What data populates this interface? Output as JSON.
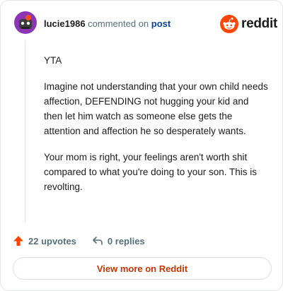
{
  "comment": {
    "username": "lucie1986",
    "action_text": "commented on",
    "target_link": "post",
    "paragraphs": [
      "YTA",
      "Imagine not understanding that your own child needs affection, DEFENDING not hugging your kid and then let him watch as someone else gets the attention and affection he so desperately wants.",
      "Your mom is right, your feelings aren't worth shit compared to what you're doing to your son. This is revolting."
    ]
  },
  "brand": {
    "name": "reddit",
    "icon": "reddit-logo-icon",
    "color": "#ff4500"
  },
  "footer": {
    "upvotes_label": "22 upvotes",
    "replies_label": "0 replies",
    "upvote_icon": "upvote-arrow-icon",
    "reply_icon": "reply-icon",
    "view_more_label": "View more on Reddit"
  },
  "colors": {
    "accent": "#ff4500",
    "link": "#0a449b",
    "view_more_text": "#c33700"
  }
}
